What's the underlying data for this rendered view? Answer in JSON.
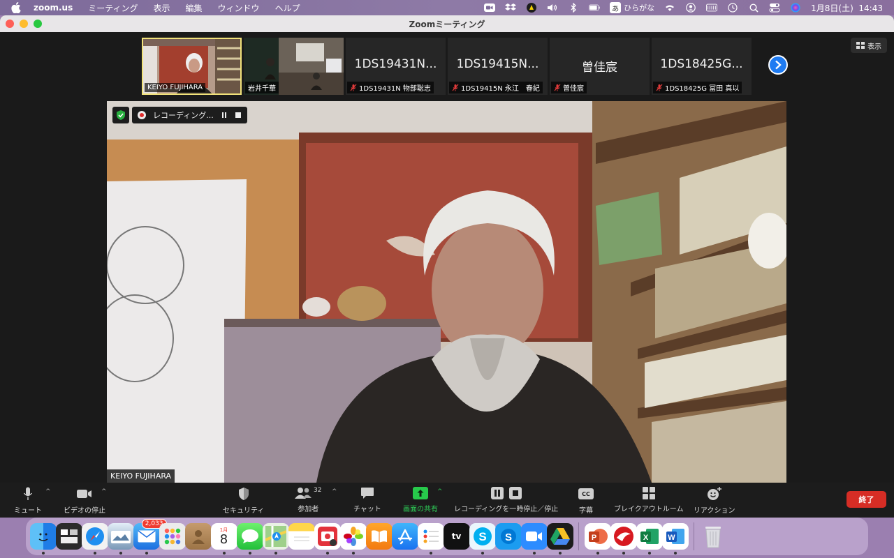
{
  "menubar": {
    "app": "zoom.us",
    "items": [
      "ミーティング",
      "表示",
      "編集",
      "ウィンドウ",
      "ヘルプ"
    ],
    "ime_label": "ひらがな",
    "ime_char": "あ",
    "clock": "1月8日(土)  14:43"
  },
  "window": {
    "title": "Zoomミーティング"
  },
  "view_button": "表示",
  "thumbnails": [
    {
      "name": "KEIYO FUJIHARA",
      "big": "",
      "muted": false,
      "active": true,
      "video": true
    },
    {
      "name": "岩井千華",
      "big": "",
      "muted": false,
      "active": false,
      "video": true
    },
    {
      "name": "1DS19431N 物部聡志",
      "big": "1DS19431N...",
      "muted": true,
      "active": false,
      "video": false
    },
    {
      "name": "1DS19415N 永江　春紀",
      "big": "1DS19415N...",
      "muted": true,
      "active": false,
      "video": false
    },
    {
      "name": "曽佳宸",
      "big": "曽佳宸",
      "muted": true,
      "active": false,
      "video": false
    },
    {
      "name": "1DS18425G 冨田 真以",
      "big": "1DS18425G...",
      "muted": true,
      "active": false,
      "video": false
    }
  ],
  "recording": {
    "label": "レコーディング..."
  },
  "main_video": {
    "speaker": "KEIYO FUJIHARA"
  },
  "toolbar": {
    "mute": "ミュート",
    "video": "ビデオの停止",
    "security": "セキュリティ",
    "participants": "参加者",
    "participants_count": "32",
    "chat": "チャット",
    "share": "画面の共有",
    "recording": "レコーディングを一時停止／停止",
    "captions": "字幕",
    "captions_icon": "CC",
    "breakout": "ブレイクアウトルーム",
    "reactions": "リアクション",
    "end": "終了"
  },
  "dock": {
    "mail_badge": "2,033",
    "calendar_month": "1月",
    "calendar_day": "8",
    "tv_label": "tv"
  },
  "colors": {
    "end_button": "#d62d25",
    "share_green": "#27c94b",
    "active_border": "#f1e27a",
    "next_button": "#1e7bf2"
  }
}
